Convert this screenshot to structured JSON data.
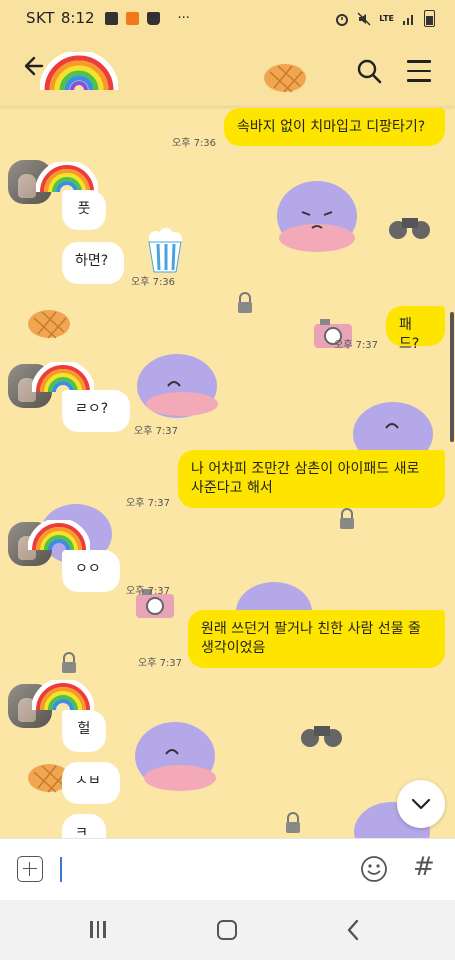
{
  "status_bar": {
    "carrier": "SKT",
    "time": "8:12",
    "more": "···",
    "network": "LTE"
  },
  "header": {
    "back_icon": "arrow-left-icon",
    "profile_icon": "rainbow-icon",
    "search_icon": "search-icon",
    "menu_icon": "hamburger-menu-icon"
  },
  "messages": [
    {
      "side": "me",
      "text": "속바지 없이 치마입고 디팡타기?",
      "time": "오후 7:36"
    },
    {
      "side": "other",
      "text": "풋"
    },
    {
      "side": "other",
      "text": "하면?",
      "time": "오후 7:36"
    },
    {
      "side": "me",
      "text": "패드?",
      "time": "오후 7:37"
    },
    {
      "side": "other",
      "text": "ㄹㅇ?",
      "time": "오후 7:37"
    },
    {
      "side": "me",
      "text": "나 어차피 조만간 삼촌이 아이패드 새로\n사준다고 해서",
      "time": "오후 7:37"
    },
    {
      "side": "other",
      "text": "ㅇㅇ",
      "time": "오후 7:37"
    },
    {
      "side": "me",
      "text": "원래 쓰던거 팔거나 친한 사람 선물 줄\n생각이었음",
      "time": "오후 7:37"
    },
    {
      "side": "other",
      "text": "헐"
    },
    {
      "side": "other",
      "text": "ㅅㅂ"
    },
    {
      "side": "other",
      "text": "ㅋ"
    }
  ],
  "colors": {
    "background": "#fbe6a6",
    "my_bubble": "#fee500",
    "other_bubble": "#ffffff"
  },
  "input": {
    "placeholder": "",
    "attach_icon": "plus-square-icon",
    "emoji_icon": "smiley-icon",
    "hash_icon": "hash-icon",
    "hash": "#"
  },
  "scroll_down_icon": "chevron-down-icon"
}
